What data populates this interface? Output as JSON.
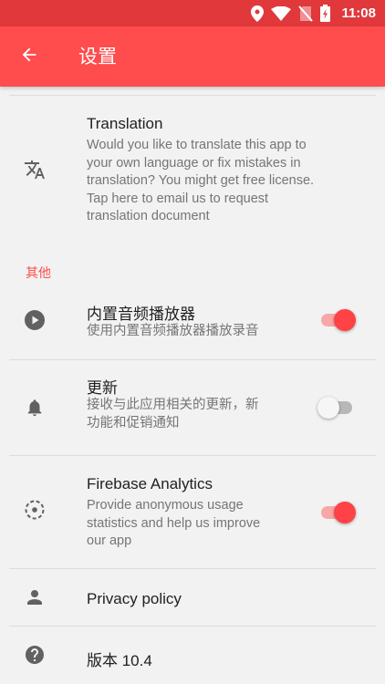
{
  "statusbar": {
    "time": "11:08",
    "icons": [
      "location-icon",
      "wifi-icon",
      "no-sim-icon",
      "battery-charging-icon"
    ]
  },
  "appbar": {
    "title": "设置",
    "back_icon": "arrow-left-icon"
  },
  "translation": {
    "icon": "translate-icon",
    "title": "Translation",
    "lines": [
      "Would you like to translate this app to",
      "your own language or fix mistakes in",
      "translation? You might get free license.",
      "Tap here to email us to request",
      "translation document"
    ]
  },
  "section_other": {
    "label": "其他"
  },
  "builtin_player": {
    "icon": "play-circle-icon",
    "title": "内置音频播放器",
    "lines": [
      "使用内置音频播放器播放录音"
    ],
    "enabled": true
  },
  "updates": {
    "icon": "bell-icon",
    "title": "更新",
    "lines": [
      "接收与此应用相关的更新，新",
      "功能和促销通知"
    ],
    "enabled": false
  },
  "analytics": {
    "icon": "analytics-dashed-circle-icon",
    "title": "Firebase Analytics",
    "lines": [
      "Provide anonymous usage",
      "statistics and help us improve",
      "our app"
    ],
    "enabled": true
  },
  "privacy": {
    "icon": "person-icon",
    "title": "Privacy policy"
  },
  "version": {
    "icon": "help-circle-icon",
    "title": "版本 10.4"
  },
  "colors": {
    "status_bar": "#e0383b",
    "app_bar": "#ff4c4d",
    "accent": "#ff4245",
    "background": "#f2f2f2"
  }
}
